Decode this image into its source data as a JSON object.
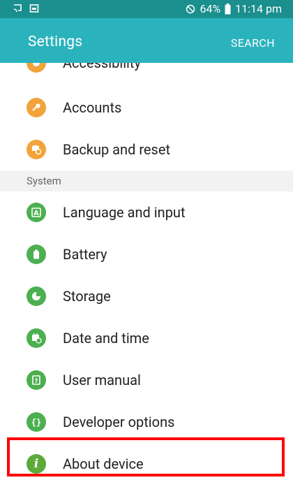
{
  "status_bar": {
    "battery_text": "64%",
    "time": "11:14 pm",
    "left_icons": [
      "cast-icon",
      "gallery-icon"
    ],
    "right_icons": [
      "blocked-icon",
      "battery-icon"
    ]
  },
  "app_bar": {
    "title": "Settings",
    "search_label": "SEARCH"
  },
  "partial_item": {
    "label": "Accessibility",
    "icon": "accessibility-icon"
  },
  "items_top": [
    {
      "label": "Accounts",
      "icon": "key-icon"
    },
    {
      "label": "Backup and reset",
      "icon": "backup-icon"
    }
  ],
  "section": {
    "label": "System"
  },
  "items_system": [
    {
      "label": "Language and input",
      "icon": "keyboard-icon"
    },
    {
      "label": "Battery",
      "icon": "battery-icon"
    },
    {
      "label": "Storage",
      "icon": "storage-icon"
    },
    {
      "label": "Date and time",
      "icon": "calendar-icon"
    },
    {
      "label": "User manual",
      "icon": "help-icon"
    },
    {
      "label": "Developer options",
      "icon": "braces-icon"
    },
    {
      "label": "About device",
      "icon": "info-icon"
    }
  ],
  "colors": {
    "status_bar": "#1b8e8e",
    "app_bar": "#2bb3bd",
    "orange_icon": "#f2a43a",
    "green_icon": "#4caf50",
    "highlight": "#ff0000"
  }
}
